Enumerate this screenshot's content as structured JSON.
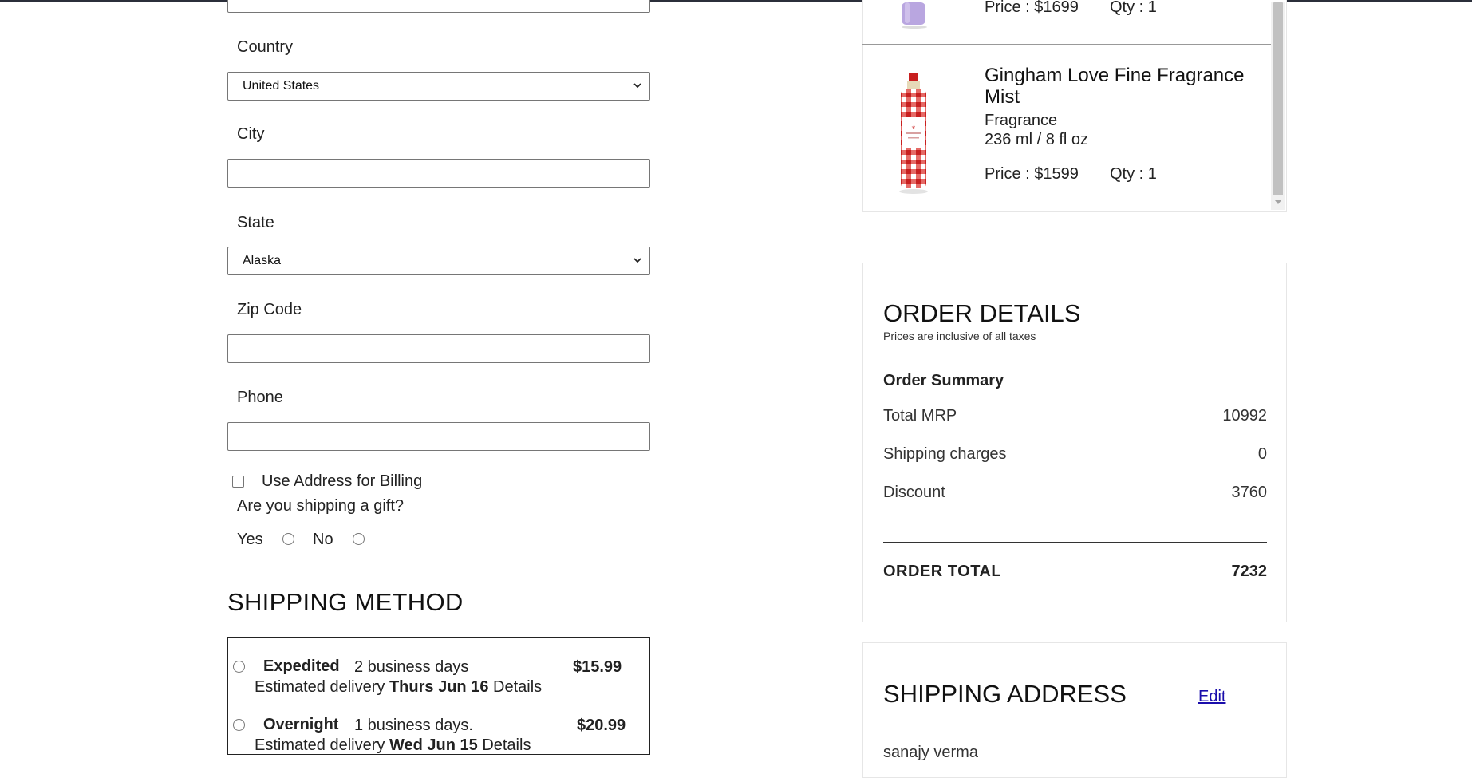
{
  "form": {
    "country_label": "Country",
    "country_value": "United States",
    "city_label": "City",
    "city_value": "",
    "state_label": "State",
    "state_value": "Alaska",
    "zip_label": "Zip Code",
    "zip_value": "",
    "phone_label": "Phone",
    "phone_value": "",
    "billing_label": "Use Address for Billing",
    "gift_question": "Are you shipping a gift?",
    "gift_yes": "Yes",
    "gift_no": "No"
  },
  "shipping_method": {
    "title": "SHIPPING METHOD",
    "options": [
      {
        "name": "Expedited",
        "days": "2 business days",
        "price": "$15.99",
        "est_prefix": "Estimated delivery",
        "est_date": "Thurs Jun 16",
        "details": "Details"
      },
      {
        "name": "Overnight",
        "days": "1 business days.",
        "price": "$20.99",
        "est_prefix": "Estimated delivery",
        "est_date": "Wed Jun 15",
        "details": "Details"
      }
    ]
  },
  "cart": {
    "items": [
      {
        "price": "Price : $1699",
        "qty": "Qty : 1"
      },
      {
        "title": "Gingham Love Fine Fragrance Mist",
        "category": "Fragrance",
        "size": "236 ml / 8 fl oz",
        "price": "Price : $1599",
        "qty": "Qty : 1"
      }
    ]
  },
  "order_details": {
    "title": "ORDER DETAILS",
    "subtitle": "Prices are inclusive of all taxes",
    "summary_heading": "Order Summary",
    "rows": [
      {
        "label": "Total MRP",
        "value": "10992"
      },
      {
        "label": "Shipping charges",
        "value": "0"
      },
      {
        "label": "Discount",
        "value": "3760"
      }
    ],
    "total_label": "ORDER TOTAL",
    "total_value": "7232"
  },
  "shipping_address": {
    "title": "SHIPPING ADDRESS",
    "edit_label": "Edit",
    "name": "sanajy verma"
  },
  "colors": {
    "link": "#1a0dab",
    "border": "#767676",
    "card_border": "#e6e6e6",
    "gingham_red": "#d9302c",
    "lavender": "#b9a6e0"
  }
}
